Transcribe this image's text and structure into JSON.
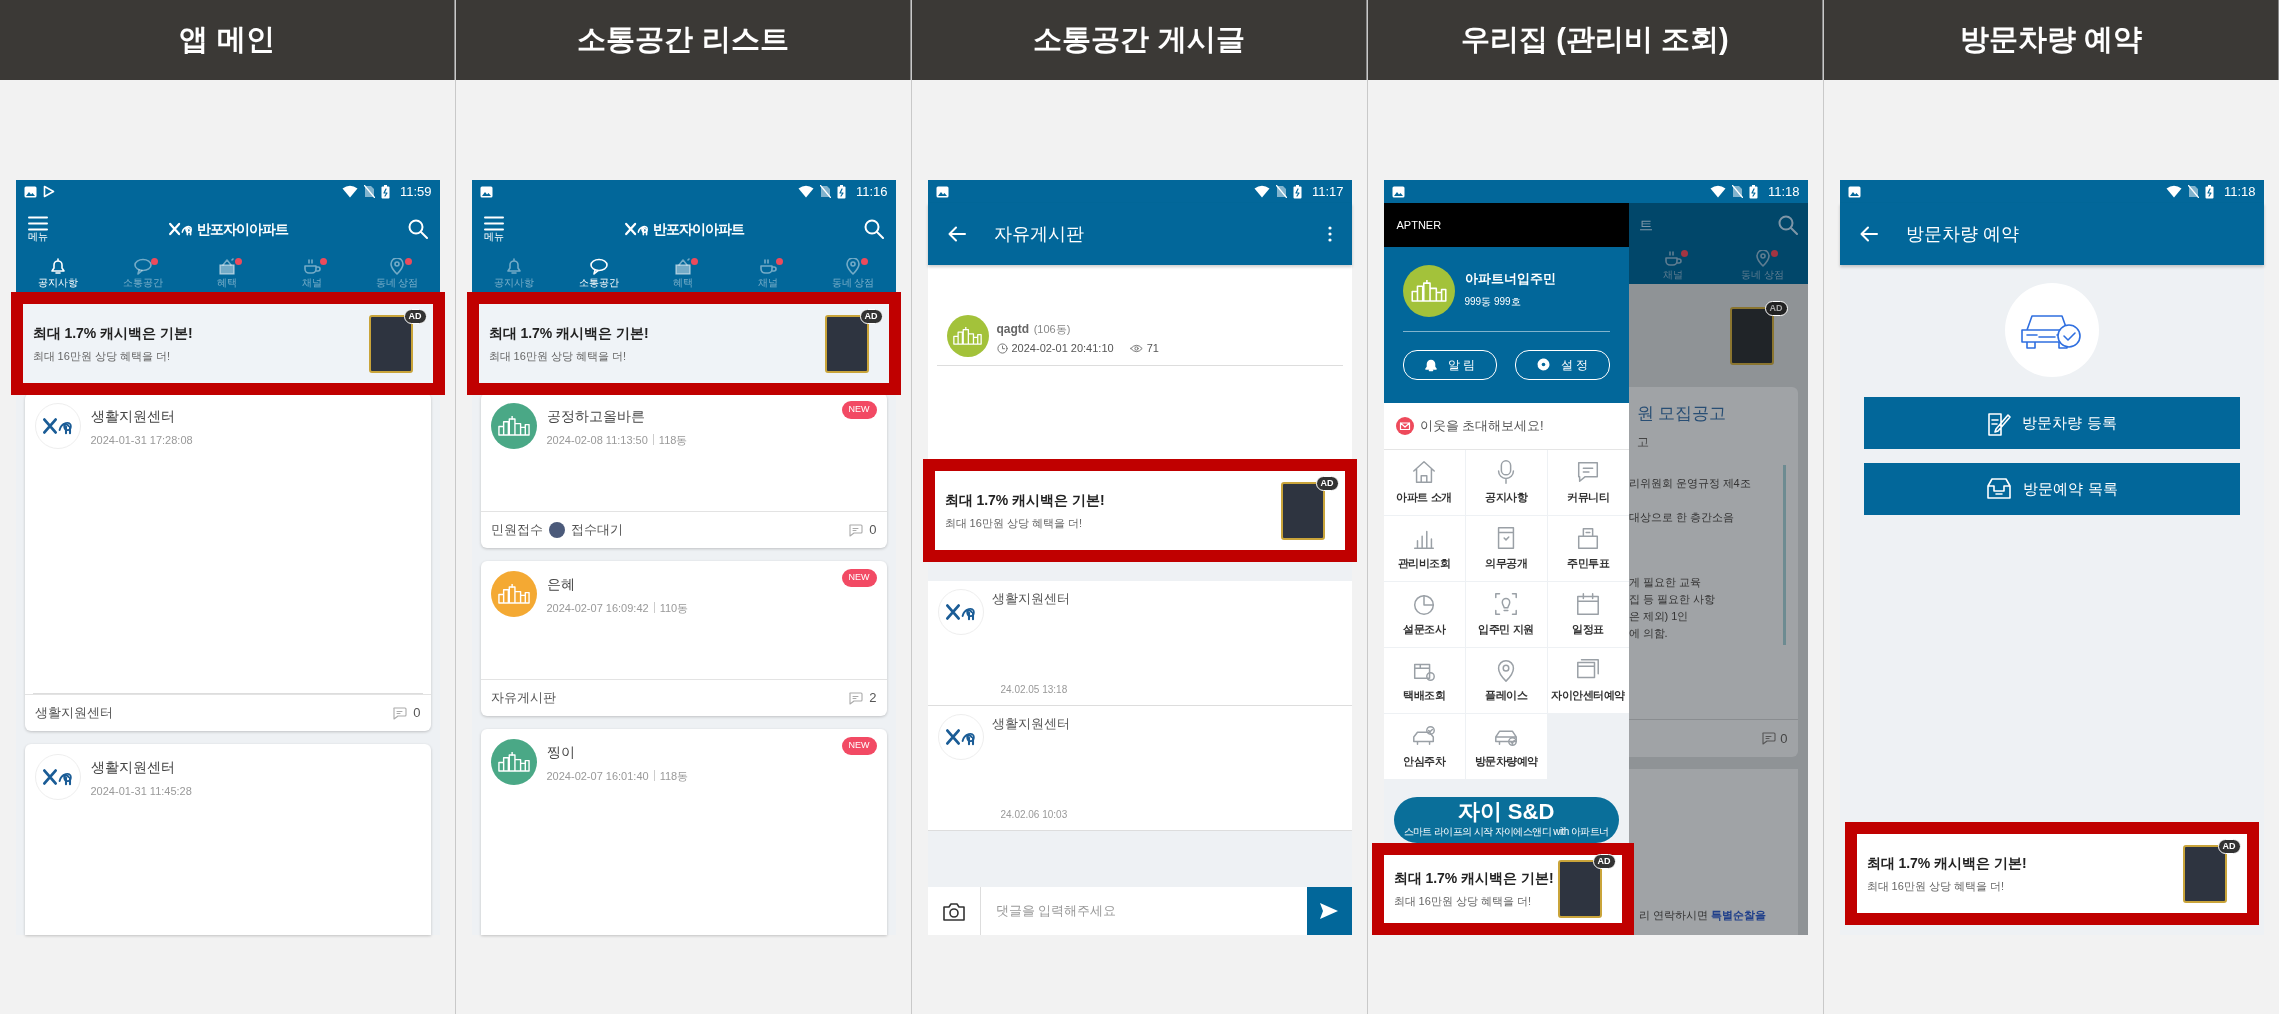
{
  "columns": [
    {
      "heading": "앱 메인",
      "screen": {
        "kind": "home",
        "status_time": "11:59",
        "app_title": "반포자이아파트",
        "menu_label": "메뉴",
        "tabs": [
          {
            "label": "공지사항",
            "selected": true,
            "dot": false
          },
          {
            "label": "소통공간",
            "selected": false,
            "dot": true
          },
          {
            "label": "혜택",
            "selected": false,
            "dot": true
          },
          {
            "label": "채널",
            "selected": false,
            "dot": true
          },
          {
            "label": "동네 상점",
            "selected": false,
            "dot": true
          }
        ],
        "ad": {
          "highlighted": true,
          "title": "최대 1.7% 캐시백은 기본!",
          "subtitle": "최대 16만원 상당 혜택을 더!",
          "badge": "AD"
        },
        "posts": [
          {
            "author": "생활지원센터",
            "date": "2024-01-31 17:28:08",
            "board": "생활지원센터",
            "comments": "0"
          },
          {
            "author": "생활지원센터",
            "date": "2024-01-31 11:45:28"
          }
        ]
      }
    },
    {
      "heading": "소통공간 리스트",
      "screen": {
        "kind": "home",
        "status_time": "11:16",
        "app_title": "반포자이아파트",
        "menu_label": "메뉴",
        "tabs": [
          {
            "label": "공지사항",
            "selected": false,
            "dot": false
          },
          {
            "label": "소통공간",
            "selected": true,
            "dot": false
          },
          {
            "label": "혜택",
            "selected": false,
            "dot": true
          },
          {
            "label": "채널",
            "selected": false,
            "dot": true
          },
          {
            "label": "동네 상점",
            "selected": false,
            "dot": true
          }
        ],
        "ad": {
          "highlighted": true,
          "title": "최대 1.7% 캐시백은 기본!",
          "subtitle": "최대 16만원 상당 혜택을 더!",
          "badge": "AD"
        },
        "posts": [
          {
            "author": "공정하고올바른",
            "color": "#4aa886",
            "date": "2024-02-08 11:13:50",
            "unit": "118동",
            "new_badge": "NEW",
            "board": "민원접수",
            "status": "접수대기",
            "comments": "0"
          },
          {
            "author": "은혜",
            "color": "#f4a933",
            "date": "2024-02-07 16:09:42",
            "unit": "110동",
            "new_badge": "NEW",
            "board": "자유게시판",
            "comments": "2"
          },
          {
            "author": "찡이",
            "color": "#4aa886",
            "date": "2024-02-07 16:01:40",
            "unit": "118동",
            "new_badge": "NEW"
          }
        ]
      }
    },
    {
      "heading": "소통공간 게시글",
      "screen": {
        "kind": "post",
        "status_time": "11:17",
        "app_title": "자유게시판",
        "author": "qagtd",
        "unit": "(106동)",
        "date": "2024-02-01 20:41:10",
        "views": "71",
        "ad": {
          "highlighted": true,
          "title": "최대 1.7% 캐시백은 기본!",
          "subtitle": "최대 16만원 상당 혜택을 더!",
          "badge": "AD"
        },
        "comments": [
          {
            "author": "생활지원센터",
            "date": "24.02.05 13:18"
          },
          {
            "author": "생활지원센터",
            "date": "24.02.06 10:03"
          }
        ],
        "comment_placeholder": "댓글을 입력해주세요"
      }
    },
    {
      "heading": "우리집 (관리비 조회)",
      "screen": {
        "kind": "drawer",
        "status_time": "11:18",
        "drawer": {
          "brand": "APTNER",
          "user_name": "아파트너입주민",
          "user_unit": "999동 999호",
          "buttons": [
            "알 림",
            "설 정"
          ],
          "invite": "이웃을 초대해보세요!",
          "menu": [
            "아파트 소개",
            "공지사항",
            "커뮤니티",
            "관리비조회",
            "의무공개",
            "주민투표",
            "설문조사",
            "입주민 지원",
            "일정표",
            "택배조회",
            "플레이스",
            "자이안센터예약",
            "안심주차",
            "방문차량예약"
          ],
          "promo_title": "자이 S&D",
          "promo_caption": "스마트 라이프의 시작 자이에스앤디 with 아파트너"
        },
        "background": {
          "title_fragment": "트",
          "tabs": [
            {
              "label": "채널",
              "dot": true
            },
            {
              "label": "동네 상점",
              "dot": true
            }
          ],
          "ad_badge": "AD",
          "notice_title": "원 모집공고",
          "notice_sub": "고",
          "lines": [
            "리위원회 운영규정 제4조",
            "대상으로 한 층간소음",
            "게 필요한 교육",
            "집 등 필요한 사항",
            "은 제외) 1인",
            "에 의함."
          ],
          "comments": "0",
          "footer_line": "리  연락하시면 **특별순찰을**"
        },
        "ad": {
          "highlighted": true,
          "title": "최대 1.7% 캐시백은 기본!",
          "subtitle": "최대 16만원 상당 혜택을 더!",
          "badge": "AD"
        }
      }
    },
    {
      "heading": "방문차량 예약",
      "screen": {
        "kind": "visitor",
        "status_time": "11:18",
        "app_title": "방문차량 예약",
        "buttons": [
          "방문차량 등록",
          "방문예약 목록"
        ],
        "ad": {
          "highlighted": true,
          "title": "최대 1.7% 캐시백은 기본!",
          "subtitle": "최대 16만원 상당 혜택을 더!",
          "badge": "AD"
        }
      }
    }
  ]
}
